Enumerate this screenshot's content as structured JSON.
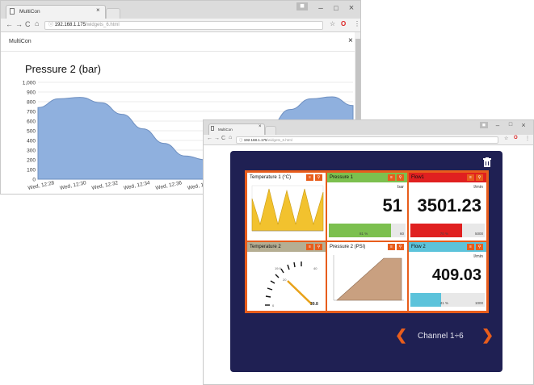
{
  "colors": {
    "accent": "#e85d1c",
    "dash_bg": "#1f2053",
    "area_blue": "#8fb0de",
    "green": "#7cc04f",
    "red": "#e02020",
    "tan": "#b89a7a",
    "teal": "#5cc3db"
  },
  "window1": {
    "tab_title": "MultiCon",
    "url_host": "192.168.1.175",
    "url_path": "/widgets_6.html",
    "page_label": "MultiCon",
    "close_glyph": "×",
    "chart_data": {
      "type": "area",
      "title": "Pressure 2 (bar)",
      "ylim": [
        0,
        1000
      ],
      "yticks": [
        "1,000",
        "900",
        "800",
        "700",
        "600",
        "500",
        "400",
        "300",
        "200",
        "100",
        "0"
      ],
      "xticks": [
        "Wed, 12:28",
        "Wed, 12:30",
        "Wed, 12:32",
        "Wed, 12:34",
        "Wed, 12:36",
        "Wed, 1"
      ],
      "series": [
        {
          "values": [
            740,
            830,
            845,
            790,
            670,
            520,
            370,
            240,
            200,
            215,
            340,
            540,
            720,
            830,
            850,
            760
          ]
        }
      ]
    }
  },
  "window2": {
    "tab_title": "MultiCon",
    "url_host": "192.168.1.175",
    "url_path": "/widgets_6.html",
    "channel_label": "Channel 1÷6",
    "tiles": [
      {
        "title": "Temperature 1 (°C)",
        "header_color": "#ffffff"
      },
      {
        "title": "Pressure 1",
        "header_color": "#7cc04f",
        "unit": "bar",
        "value": "51",
        "percent": 0.81,
        "pct_label": "81 %",
        "max": "60"
      },
      {
        "title": "Flow1",
        "header_color": "#e02020",
        "unit": "l/min",
        "value": "3501.23",
        "percent": 0.7,
        "pct_label": "70 %",
        "max": "5000"
      },
      {
        "title": "Temperature 2",
        "header_color": "#b5ae93",
        "gauge_value": "39.8",
        "gauge_ticks": [
          "0",
          "19.9",
          "20",
          "40"
        ]
      },
      {
        "title": "Pressure 2 (PSI)",
        "header_color": "#ffffff"
      },
      {
        "title": "Flow 2",
        "header_color": "#5cc3db",
        "unit": "l/min",
        "value": "409.03",
        "percent": 0.41,
        "pct_label": "41 %",
        "max": "1000"
      }
    ]
  }
}
